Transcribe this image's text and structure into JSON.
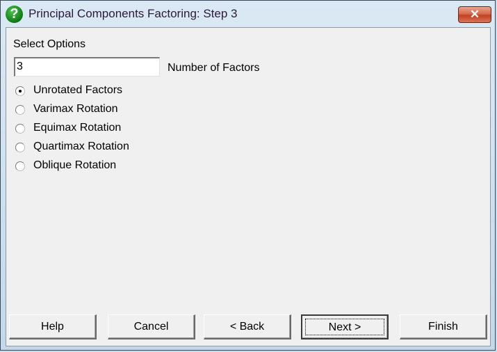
{
  "window": {
    "title": "Principal Components Factoring: Step 3",
    "icon": "question-icon",
    "close_glyph": "✕"
  },
  "options": {
    "heading": "Select Options",
    "factors_value": "3",
    "factors_label": "Number of Factors",
    "radios": [
      {
        "label": "Unrotated Factors",
        "checked": true
      },
      {
        "label": "Varimax Rotation",
        "checked": false
      },
      {
        "label": "Equimax Rotation",
        "checked": false
      },
      {
        "label": "Quartimax Rotation",
        "checked": false
      },
      {
        "label": "Oblique Rotation",
        "checked": false
      }
    ]
  },
  "buttons": {
    "help": "Help",
    "cancel": "Cancel",
    "back": "< Back",
    "next": "Next >",
    "finish": "Finish"
  }
}
